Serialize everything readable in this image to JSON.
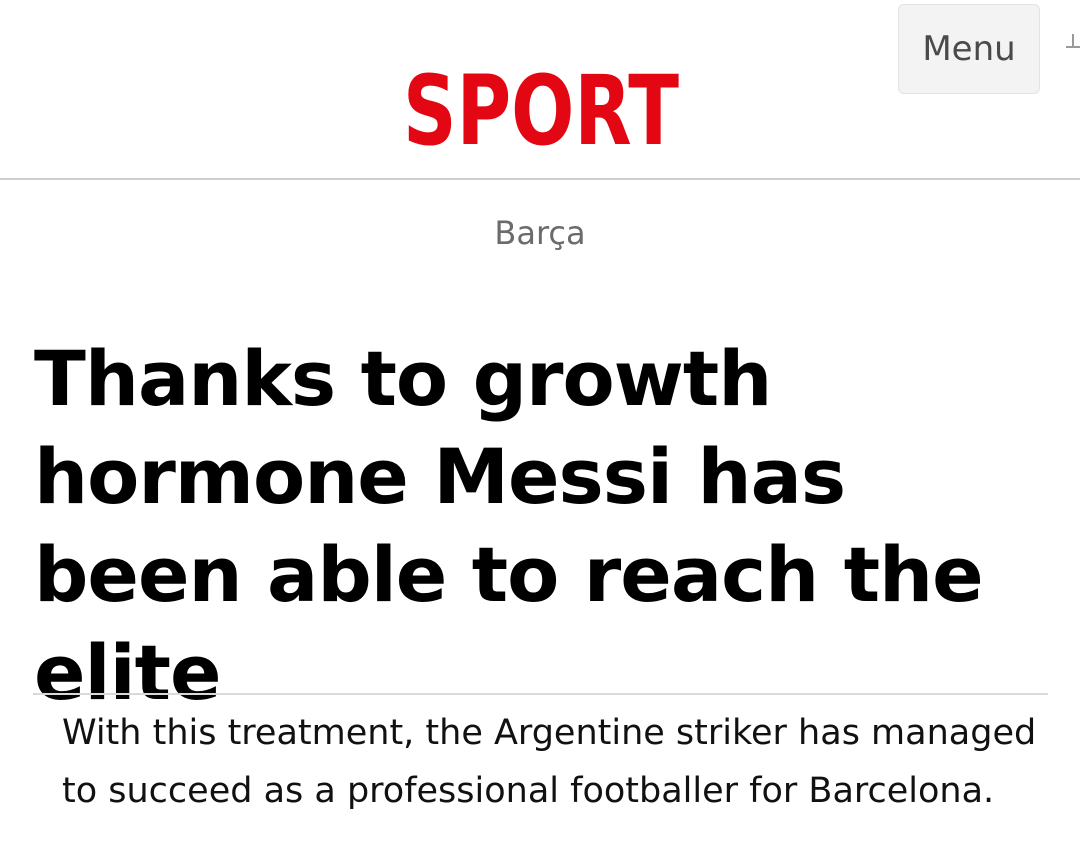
{
  "header": {
    "logo_text": "SPORT",
    "menu_label": "Menu"
  },
  "colors": {
    "brand_red": "#e30613",
    "section_gray": "#6b6b6b",
    "divider_gray": "#d9d9d9"
  },
  "article": {
    "section": "Barça",
    "headline": "Thanks to growth hormone Messi has been able to reach the elite",
    "subtitle": "With this treatment, the Argentine striker has managed to succeed as a professional footballer for Barcelona."
  },
  "icons": {
    "logo": "sport-logo",
    "edge": "partial-icon"
  }
}
